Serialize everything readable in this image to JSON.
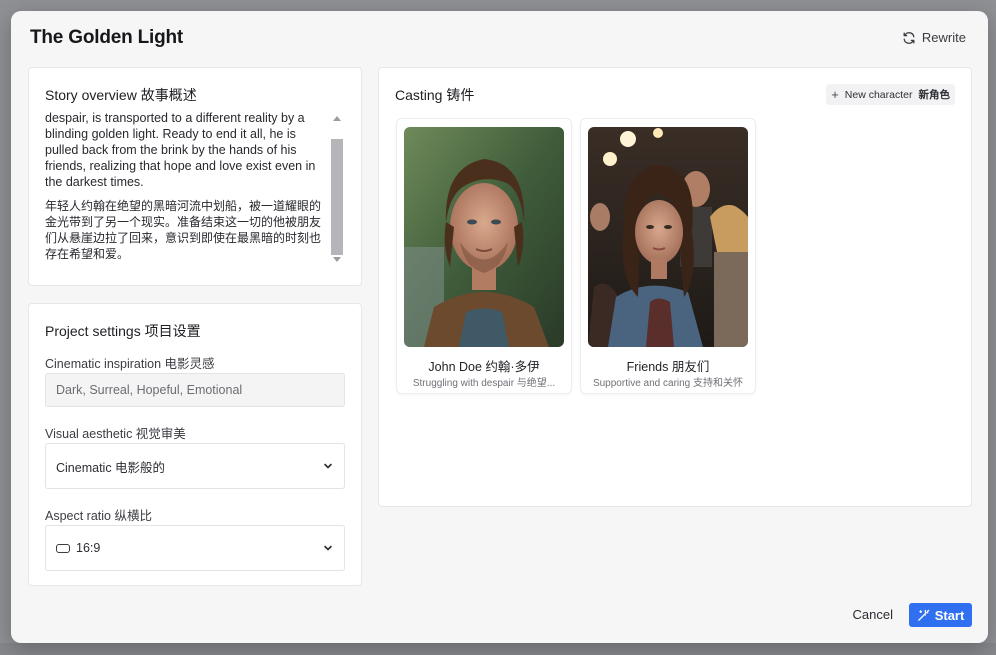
{
  "modal": {
    "title": "The Golden Light",
    "rewrite_label": "Rewrite"
  },
  "story": {
    "title": "Story overview 故事概述",
    "paragraph_en": "despair, is transported to a different reality by a blinding golden light. Ready to end it all, he is pulled back from the brink by the hands of his friends, realizing that hope and love exist even in the darkest times.",
    "paragraph_zh": "年轻人约翰在绝望的黑暗河流中划船，被一道耀眼的金光带到了另一个现实。准备结束这一切的他被朋友们从悬崖边拉了回来，意识到即使在最黑暗的时刻也存在希望和爱。"
  },
  "settings": {
    "title": "Project settings 项目设置",
    "inspiration_label": "Cinematic inspiration 电影灵感",
    "inspiration_value": "Dark, Surreal, Hopeful, Emotional",
    "aesthetic_label": "Visual aesthetic 视觉审美",
    "aesthetic_value": "Cinematic  电影般的",
    "ratio_label": "Aspect ratio 纵横比",
    "ratio_value": "16:9"
  },
  "casting": {
    "title": "Casting 铸件",
    "new_character_en": "New character",
    "new_character_zh": "新角色",
    "characters": [
      {
        "name": "John Doe 约翰·多伊",
        "description": "Struggling with despair 与绝望..."
      },
      {
        "name": "Friends 朋友们",
        "description": "Supportive and caring 支持和关怀"
      }
    ]
  },
  "footer": {
    "cancel_label": "Cancel",
    "start_label": "Start"
  },
  "colors": {
    "accent": "#2f6ff0",
    "modal_bg": "#f6f6f7",
    "card_bg": "#ffffff"
  }
}
